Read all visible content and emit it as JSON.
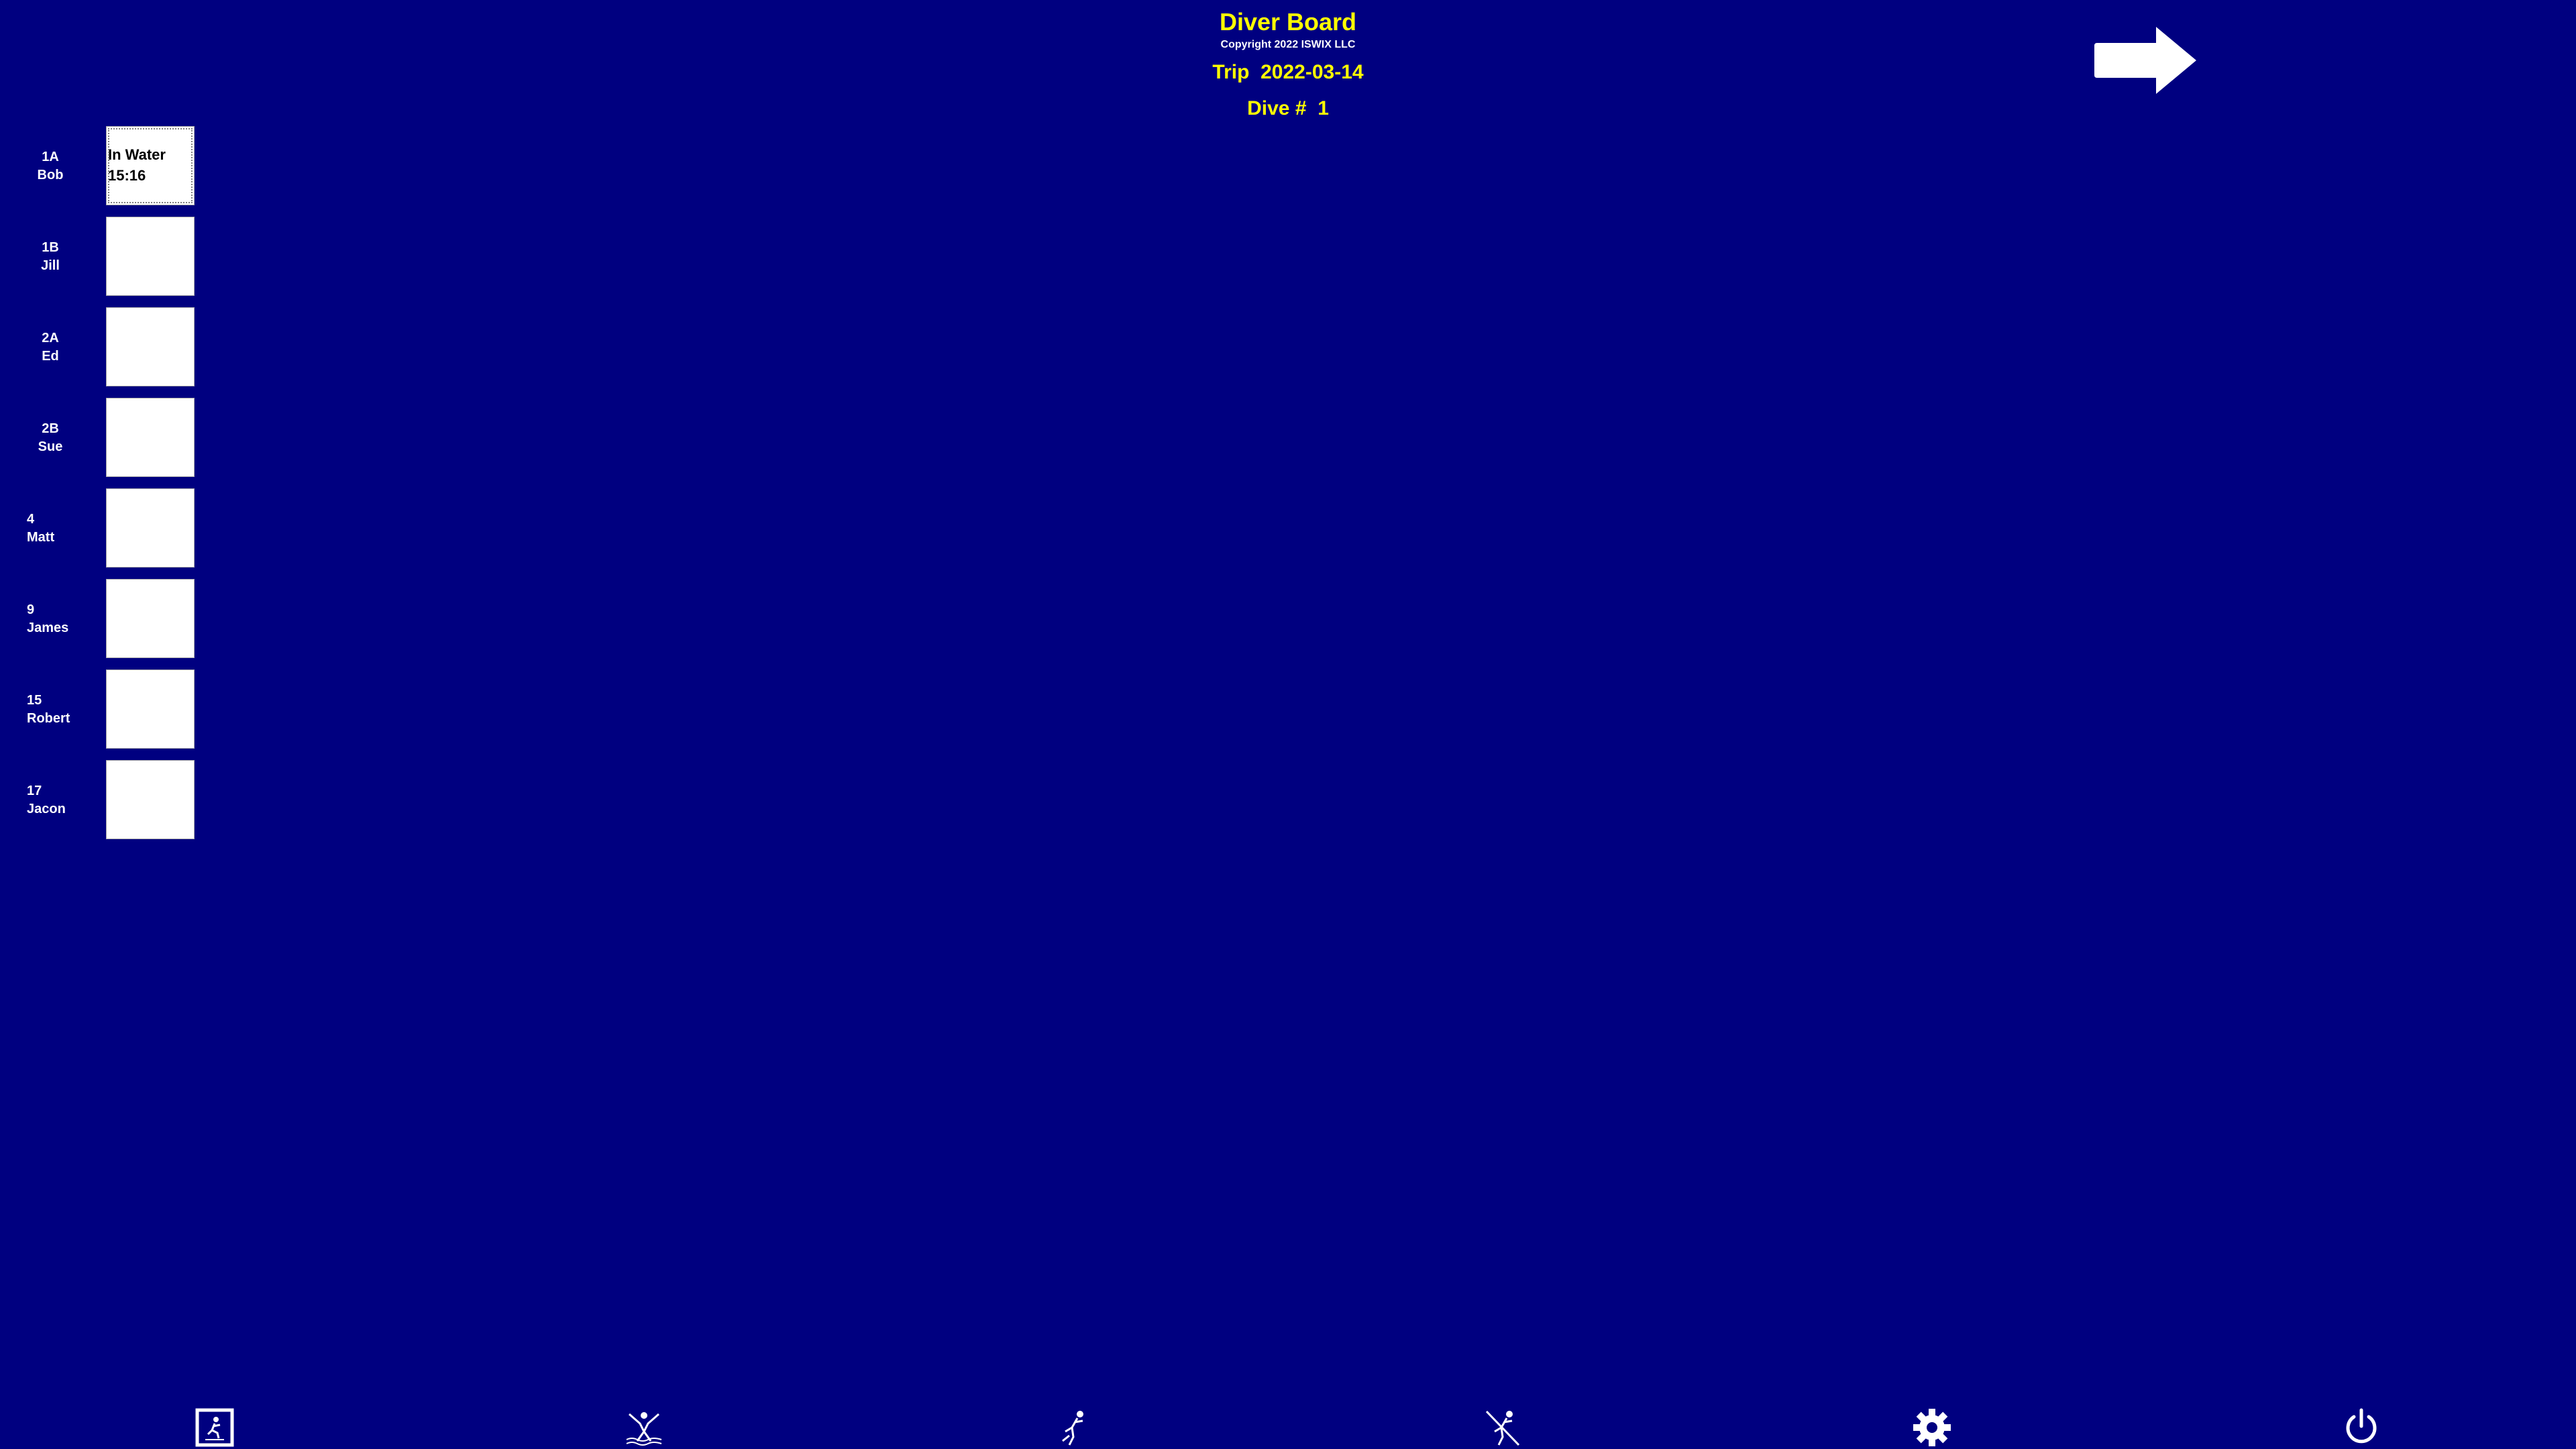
{
  "header": {
    "title": "Diver Board",
    "copyright": "Copyright 2022 ISWIX LLC",
    "trip_label": "Trip",
    "trip_date": "2022-03-14",
    "dive_label": "Dive #",
    "dive_number": "1"
  },
  "navigation": {
    "next_icon": "right-arrow-icon"
  },
  "divers": [
    {
      "id": "1A",
      "name": "Bob",
      "status": "In Water",
      "time": "15:16"
    },
    {
      "id": "1B",
      "name": "Jill",
      "status": "",
      "time": ""
    },
    {
      "id": "2A",
      "name": "Ed",
      "status": "",
      "time": ""
    },
    {
      "id": "2B",
      "name": "Sue",
      "status": "",
      "time": ""
    },
    {
      "id": "4",
      "name": "Matt",
      "status": "",
      "time": ""
    },
    {
      "id": "9",
      "name": "James",
      "status": "",
      "time": ""
    },
    {
      "id": "15",
      "name": "Robert",
      "status": "",
      "time": ""
    },
    {
      "id": "17",
      "name": "Jacon",
      "status": "",
      "time": ""
    }
  ],
  "toolbar": {
    "icons": [
      "dive-log-icon",
      "diver-in-icon",
      "diver-out-icon",
      "diver-surface-icon",
      "gear-icon",
      "power-icon"
    ]
  },
  "colors": {
    "background": "#000080",
    "title_text": "#ffff00",
    "label_text": "#ffffff",
    "status_box": "#ffffff"
  }
}
